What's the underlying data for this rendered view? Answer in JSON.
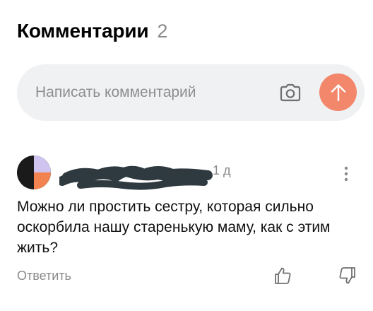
{
  "header": {
    "title": "Комментарии",
    "count": "2"
  },
  "composer": {
    "placeholder": "Написать комментарий",
    "camera_icon": "camera-icon",
    "send_icon": "arrow-up-icon",
    "send_color": "#f3876b"
  },
  "comment": {
    "author_name_redacted": true,
    "timestamp": "1 д",
    "text": "Можно ли простить сестру, которая сильно оскорбила нашу старенькую маму, как с этим жить?",
    "reply_label": "Ответить",
    "more_icon": "more-vertical-icon",
    "like_icon": "thumbs-up-icon",
    "dislike_icon": "thumbs-down-icon",
    "avatar_colors": [
      "#1a1a1a",
      "#f2824f",
      "#cfc3f0"
    ]
  }
}
